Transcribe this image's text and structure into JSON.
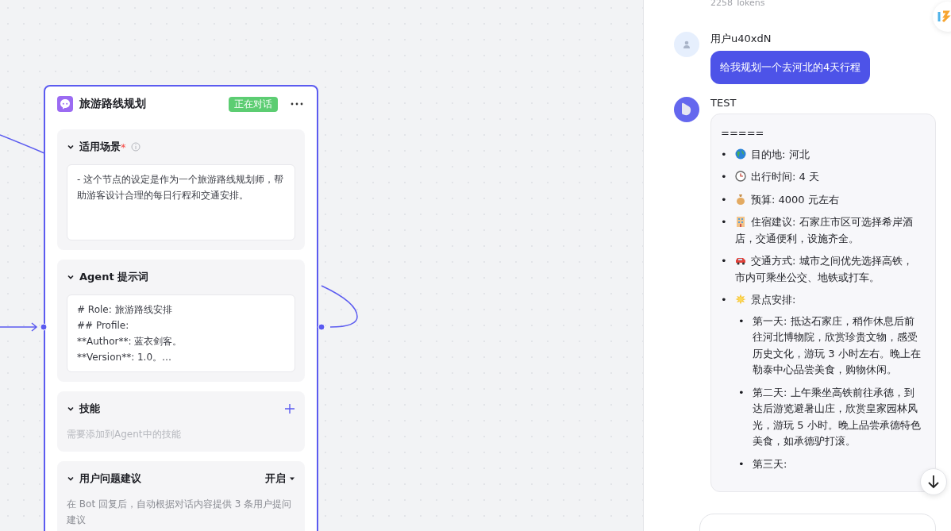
{
  "canvas": {
    "node": {
      "title": "旅游路线规划",
      "status": "正在对话",
      "sections": [
        {
          "kind": "textarea",
          "title": "适用场景",
          "title_mark": "*",
          "info": true,
          "expanded": true,
          "text": "- 这个节点的设定是作为一个旅游路线规划师，帮助游客设计合理的每日行程和交通安排。"
        },
        {
          "kind": "lines",
          "title": "Agent 提示词",
          "info": false,
          "expanded": true,
          "lines": [
            "# Role: 旅游路线安排",
            "## Profile:",
            "**Author**: 蓝衣剑客。",
            "**Version**: 1.0。…"
          ]
        },
        {
          "kind": "skills",
          "title": "技能",
          "info": false,
          "expanded": true,
          "hint": "需要添加到Agent中的技能"
        },
        {
          "kind": "suggest",
          "title": "用户问题建议",
          "info": false,
          "expanded": true,
          "value": "开启",
          "hint": "在 Bot 回复后，自动根据对话内容提供 3 条用户提问建议"
        }
      ]
    }
  },
  "chat": {
    "tokens": "2258 Tokens",
    "messages": [
      {
        "kind": "user",
        "name": "用户u40xdN",
        "text": "给我规划一个去河北的4天行程"
      },
      {
        "kind": "bot",
        "name": "TEST",
        "intro": "=====",
        "items": [
          {
            "marker": "•",
            "kind": "globe",
            "text": "目的地: 河北"
          },
          {
            "marker": "•",
            "kind": "clock",
            "text": "出行时间: 4 天"
          },
          {
            "marker": "•",
            "kind": "moneybag",
            "text": "预算: 4000 元左右"
          },
          {
            "marker": "•",
            "kind": "hotel",
            "text": "住宿建议: 石家庄市区可选择希岸酒店，交通便利，设施齐全。"
          },
          {
            "marker": "•",
            "kind": "car",
            "text": "交通方式: 城市之间优先选择高铁，市内可乘坐公交、地铁或打车。"
          },
          {
            "marker": "•",
            "kind": "sun",
            "text": "景点安排:",
            "children": [
              {
                "marker": "•",
                "text": "第一天: 抵达石家庄，稍作休息后前往河北博物院，欣赏珍贵文物，感受历史文化，游玩 3 小时左右。晚上在勒泰中心品尝美食，购物休闲。"
              },
              {
                "marker": "•",
                "text": "第二天: 上午乘坐高铁前往承德，到达后游览避暑山庄，欣赏皇家园林风光，游玩 5 小时。晚上品尝承德特色美食，如承德驴打滚。"
              },
              {
                "marker": "•",
                "text": "第三天:"
              }
            ]
          }
        ]
      }
    ]
  }
}
